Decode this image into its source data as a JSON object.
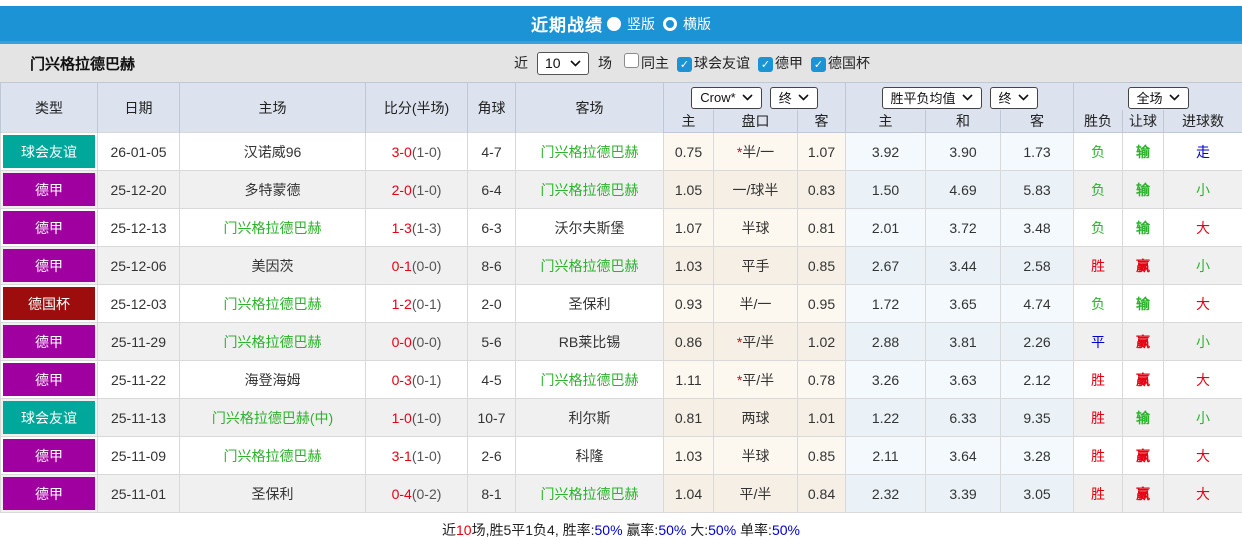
{
  "colors": {
    "accent_blue": "#1b93d5",
    "type": {
      "球会友谊": "#00a79b",
      "德甲": "#a000a0",
      "德国杯": "#9e0d0d"
    },
    "result": {
      "red": "#e60012",
      "green": "#2bb32b",
      "blue": "#0000cc"
    }
  },
  "titlebar": {
    "title": "近期战绩",
    "options": [
      {
        "label": "竖版",
        "selected": true
      },
      {
        "label": "横版",
        "selected": false
      }
    ]
  },
  "filterbar": {
    "team": "门兴格拉德巴赫",
    "near_label": "近",
    "count_value": "10",
    "games_label": "场",
    "checkboxes": [
      {
        "label": "同主",
        "checked": false
      },
      {
        "label": "球会友谊",
        "checked": true
      },
      {
        "label": "德甲",
        "checked": true
      },
      {
        "label": "德国杯",
        "checked": true
      }
    ]
  },
  "table": {
    "left_headers": [
      "类型",
      "日期",
      "主场",
      "比分(半场)",
      "角球",
      "客场"
    ],
    "groups": [
      {
        "selects": [
          "Crow*",
          "终"
        ],
        "cols": [
          "主",
          "盘口",
          "客"
        ]
      },
      {
        "selects": [
          "胜平负均值",
          "终"
        ],
        "cols": [
          "主",
          "和",
          "客"
        ]
      },
      {
        "selects": [
          "全场"
        ],
        "cols": [
          "胜负",
          "让球",
          "进球数"
        ]
      }
    ],
    "rows": [
      {
        "type": "球会友谊",
        "date": "26-01-05",
        "home": {
          "name": "汉诺威96",
          "green": false
        },
        "score": {
          "full": "3-0",
          "half": "(1-0)"
        },
        "corners": "4-7",
        "away": {
          "name": "门兴格拉德巴赫",
          "green": true
        },
        "odds": {
          "home": "0.75",
          "star": true,
          "handicap": "半/一",
          "away": "1.07"
        },
        "avg": [
          "3.92",
          "3.90",
          "1.73"
        ],
        "results": {
          "wdl": {
            "text": "负",
            "color": "green"
          },
          "handicap": {
            "text": "输",
            "color": "green"
          },
          "goals": {
            "text": "走",
            "color": "blue"
          }
        }
      },
      {
        "type": "德甲",
        "date": "25-12-20",
        "home": {
          "name": "多特蒙德",
          "green": false
        },
        "score": {
          "full": "2-0",
          "half": "(1-0)"
        },
        "corners": "6-4",
        "away": {
          "name": "门兴格拉德巴赫",
          "green": true
        },
        "odds": {
          "home": "1.05",
          "star": false,
          "handicap": "一/球半",
          "away": "0.83"
        },
        "avg": [
          "1.50",
          "4.69",
          "5.83"
        ],
        "results": {
          "wdl": {
            "text": "负",
            "color": "green"
          },
          "handicap": {
            "text": "输",
            "color": "green"
          },
          "goals": {
            "text": "小",
            "color": "green"
          }
        }
      },
      {
        "type": "德甲",
        "date": "25-12-13",
        "home": {
          "name": "门兴格拉德巴赫",
          "green": true
        },
        "score": {
          "full": "1-3",
          "half": "(1-3)"
        },
        "corners": "6-3",
        "away": {
          "name": "沃尔夫斯堡",
          "green": false
        },
        "odds": {
          "home": "1.07",
          "star": false,
          "handicap": "半球",
          "away": "0.81"
        },
        "avg": [
          "2.01",
          "3.72",
          "3.48"
        ],
        "results": {
          "wdl": {
            "text": "负",
            "color": "green"
          },
          "handicap": {
            "text": "输",
            "color": "green"
          },
          "goals": {
            "text": "大",
            "color": "red"
          }
        }
      },
      {
        "type": "德甲",
        "date": "25-12-06",
        "home": {
          "name": "美因茨",
          "green": false
        },
        "score": {
          "full": "0-1",
          "half": "(0-0)"
        },
        "corners": "8-6",
        "away": {
          "name": "门兴格拉德巴赫",
          "green": true
        },
        "odds": {
          "home": "1.03",
          "star": false,
          "handicap": "平手",
          "away": "0.85"
        },
        "avg": [
          "2.67",
          "3.44",
          "2.58"
        ],
        "results": {
          "wdl": {
            "text": "胜",
            "color": "red"
          },
          "handicap": {
            "text": "赢",
            "color": "red"
          },
          "goals": {
            "text": "小",
            "color": "green"
          }
        }
      },
      {
        "type": "德国杯",
        "date": "25-12-03",
        "home": {
          "name": "门兴格拉德巴赫",
          "green": true
        },
        "score": {
          "full": "1-2",
          "half": "(0-1)"
        },
        "corners": "2-0",
        "away": {
          "name": "圣保利",
          "green": false
        },
        "odds": {
          "home": "0.93",
          "star": false,
          "handicap": "半/一",
          "away": "0.95"
        },
        "avg": [
          "1.72",
          "3.65",
          "4.74"
        ],
        "results": {
          "wdl": {
            "text": "负",
            "color": "green"
          },
          "handicap": {
            "text": "输",
            "color": "green"
          },
          "goals": {
            "text": "大",
            "color": "red"
          }
        }
      },
      {
        "type": "德甲",
        "date": "25-11-29",
        "home": {
          "name": "门兴格拉德巴赫",
          "green": true
        },
        "score": {
          "full": "0-0",
          "half": "(0-0)"
        },
        "corners": "5-6",
        "away": {
          "name": "RB莱比锡",
          "green": false
        },
        "odds": {
          "home": "0.86",
          "star": true,
          "handicap": "平/半",
          "away": "1.02"
        },
        "avg": [
          "2.88",
          "3.81",
          "2.26"
        ],
        "results": {
          "wdl": {
            "text": "平",
            "color": "blue"
          },
          "handicap": {
            "text": "赢",
            "color": "red"
          },
          "goals": {
            "text": "小",
            "color": "green"
          }
        }
      },
      {
        "type": "德甲",
        "date": "25-11-22",
        "home": {
          "name": "海登海姆",
          "green": false
        },
        "score": {
          "full": "0-3",
          "half": "(0-1)"
        },
        "corners": "4-5",
        "away": {
          "name": "门兴格拉德巴赫",
          "green": true
        },
        "odds": {
          "home": "1.11",
          "star": true,
          "handicap": "平/半",
          "away": "0.78"
        },
        "avg": [
          "3.26",
          "3.63",
          "2.12"
        ],
        "results": {
          "wdl": {
            "text": "胜",
            "color": "red"
          },
          "handicap": {
            "text": "赢",
            "color": "red"
          },
          "goals": {
            "text": "大",
            "color": "red"
          }
        }
      },
      {
        "type": "球会友谊",
        "date": "25-11-13",
        "home": {
          "name": "门兴格拉德巴赫(中)",
          "green": true
        },
        "score": {
          "full": "1-0",
          "half": "(1-0)"
        },
        "corners": "10-7",
        "away": {
          "name": "利尔斯",
          "green": false
        },
        "odds": {
          "home": "0.81",
          "star": false,
          "handicap": "两球",
          "away": "1.01"
        },
        "avg": [
          "1.22",
          "6.33",
          "9.35"
        ],
        "results": {
          "wdl": {
            "text": "胜",
            "color": "red"
          },
          "handicap": {
            "text": "输",
            "color": "green"
          },
          "goals": {
            "text": "小",
            "color": "green"
          }
        }
      },
      {
        "type": "德甲",
        "date": "25-11-09",
        "home": {
          "name": "门兴格拉德巴赫",
          "green": true
        },
        "score": {
          "full": "3-1",
          "half": "(1-0)"
        },
        "corners": "2-6",
        "away": {
          "name": "科隆",
          "green": false
        },
        "odds": {
          "home": "1.03",
          "star": false,
          "handicap": "半球",
          "away": "0.85"
        },
        "avg": [
          "2.11",
          "3.64",
          "3.28"
        ],
        "results": {
          "wdl": {
            "text": "胜",
            "color": "red"
          },
          "handicap": {
            "text": "赢",
            "color": "red"
          },
          "goals": {
            "text": "大",
            "color": "red"
          }
        }
      },
      {
        "type": "德甲",
        "date": "25-11-01",
        "home": {
          "name": "圣保利",
          "green": false
        },
        "score": {
          "full": "0-4",
          "half": "(0-2)"
        },
        "corners": "8-1",
        "away": {
          "name": "门兴格拉德巴赫",
          "green": true
        },
        "odds": {
          "home": "1.04",
          "star": false,
          "handicap": "平/半",
          "away": "0.84"
        },
        "avg": [
          "2.32",
          "3.39",
          "3.05"
        ],
        "results": {
          "wdl": {
            "text": "胜",
            "color": "red"
          },
          "handicap": {
            "text": "赢",
            "color": "red"
          },
          "goals": {
            "text": "大",
            "color": "red"
          }
        }
      }
    ]
  },
  "footer": {
    "segments": [
      {
        "text": "近",
        "color": "black"
      },
      {
        "text": "10",
        "color": "red"
      },
      {
        "text": "场,胜5平1负4, 胜率:",
        "color": "black"
      },
      {
        "text": "50%",
        "color": "blue"
      },
      {
        "text": " 赢率:",
        "color": "black"
      },
      {
        "text": "50%",
        "color": "blue"
      },
      {
        "text": " 大:",
        "color": "black"
      },
      {
        "text": "50%",
        "color": "blue"
      },
      {
        "text": " 单率:",
        "color": "black"
      },
      {
        "text": "50%",
        "color": "blue"
      }
    ]
  }
}
